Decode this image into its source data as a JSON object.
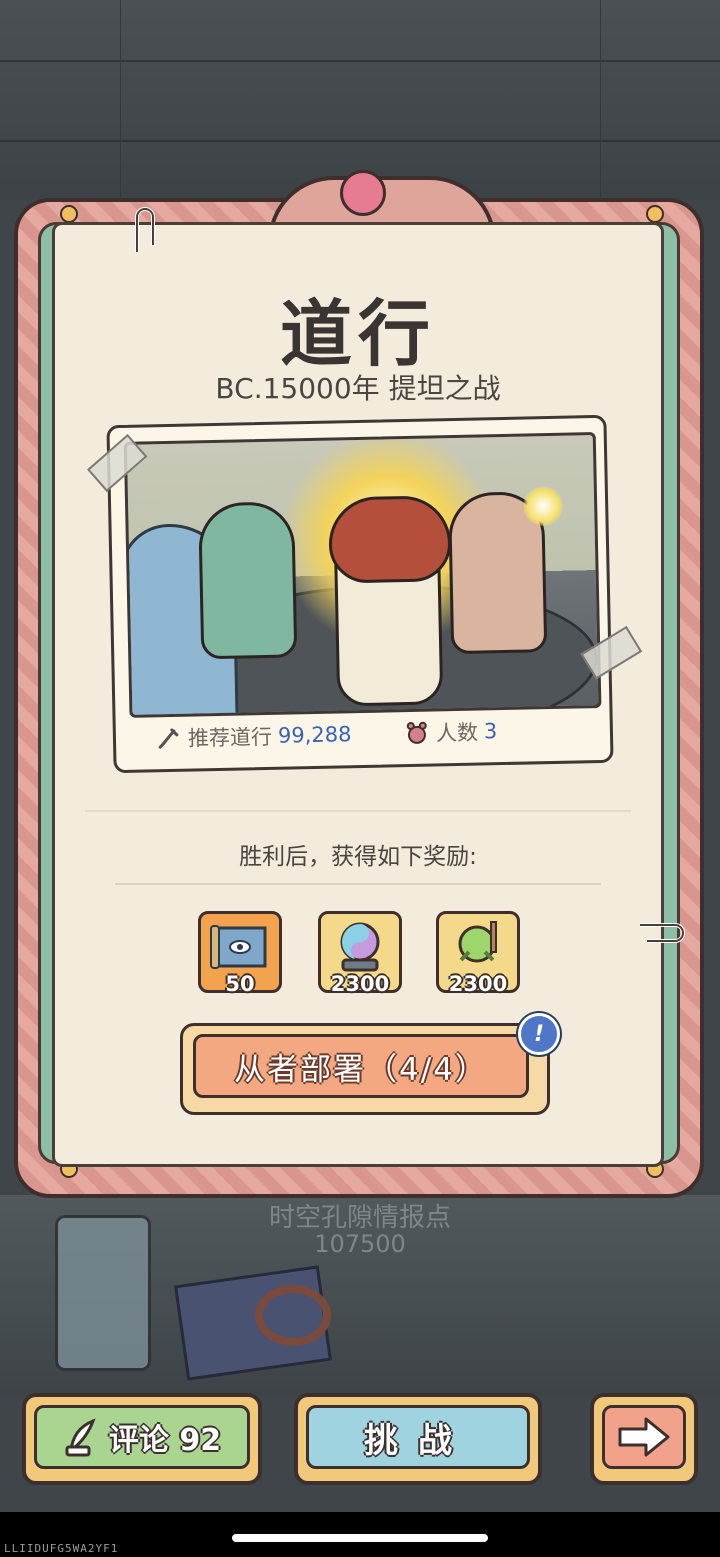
{
  "stage": {
    "title": "道行",
    "subtitle": "BC.15000年  提坦之战"
  },
  "battle_info": {
    "recommended_label": "推荐道行",
    "recommended_value": "99,288",
    "party_label": "人数",
    "party_value": "3"
  },
  "rewards": {
    "heading": "胜利后，获得如下奖励:",
    "items": [
      {
        "icon": "scroll-map-icon",
        "count": "50"
      },
      {
        "icon": "crystal-ball-icon",
        "count": "2300"
      },
      {
        "icon": "green-orb-icon",
        "count": "2300"
      }
    ]
  },
  "deploy_button": {
    "label": "从者部署（4/4）",
    "badge": "!"
  },
  "intel": {
    "label": "时空孔隙情报点",
    "value": "107500"
  },
  "bottom_buttons": {
    "comment_label": "评论 92",
    "challenge_label": "挑战",
    "next_icon": "arrow-right-icon"
  },
  "device_id": "LLIIDUFG5WA2YF1",
  "colors": {
    "frame_pink": "#e6a9a0",
    "frame_green": "#8dbfa7",
    "paper": "#f3ecdc",
    "highlight_blue": "#3a62b4",
    "deploy_orange": "#f3a882",
    "comment_green": "#a9d591",
    "challenge_blue": "#9ed3df",
    "next_salmon": "#f2a18b"
  }
}
